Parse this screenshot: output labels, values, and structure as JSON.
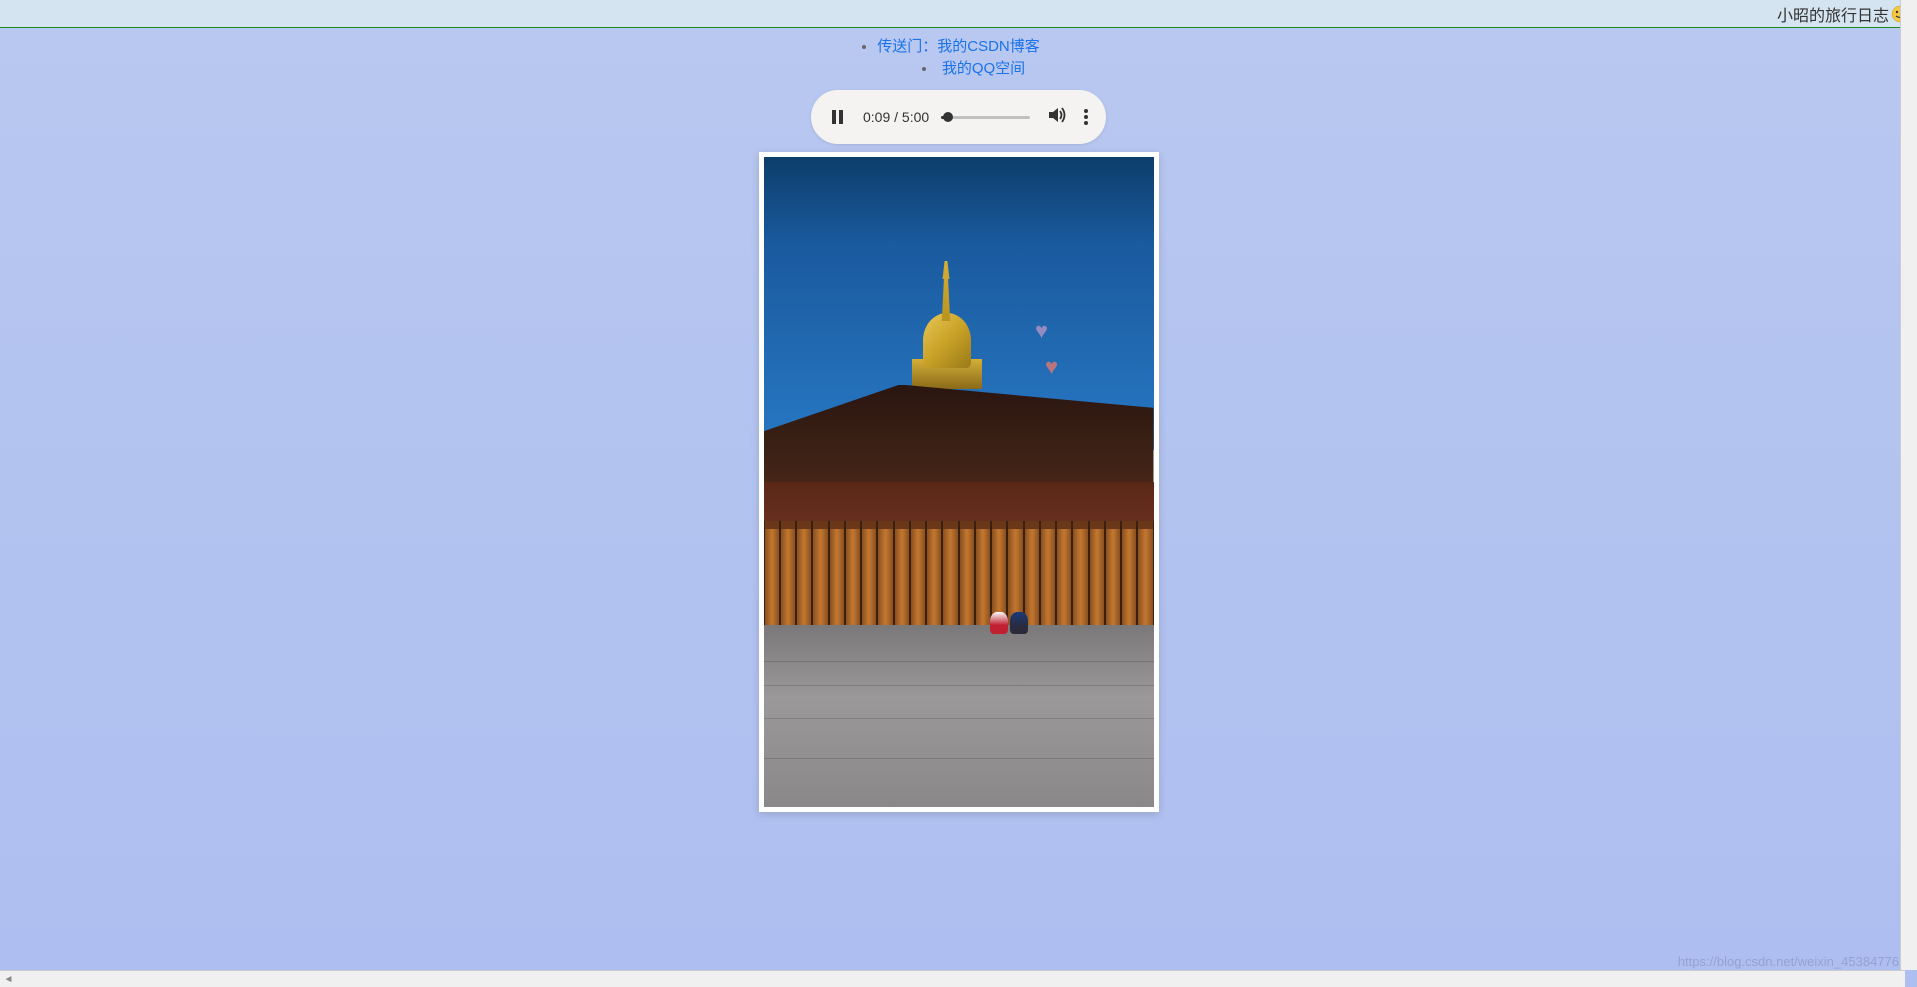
{
  "header": {
    "title": "小昭的旅行日志",
    "emoji": "🙂"
  },
  "links": {
    "prefix": "传送门：",
    "items": [
      {
        "label": "我的CSDN博客"
      },
      {
        "label": "我的QQ空间"
      }
    ]
  },
  "audio": {
    "current_time": "0:09",
    "total_time": "5:00",
    "separator": " / ",
    "progress_percent": 8
  },
  "decorations": {
    "heart1": "♥",
    "heart2": "♥"
  },
  "watermark": "https://blog.csdn.net/weixin_45384776"
}
